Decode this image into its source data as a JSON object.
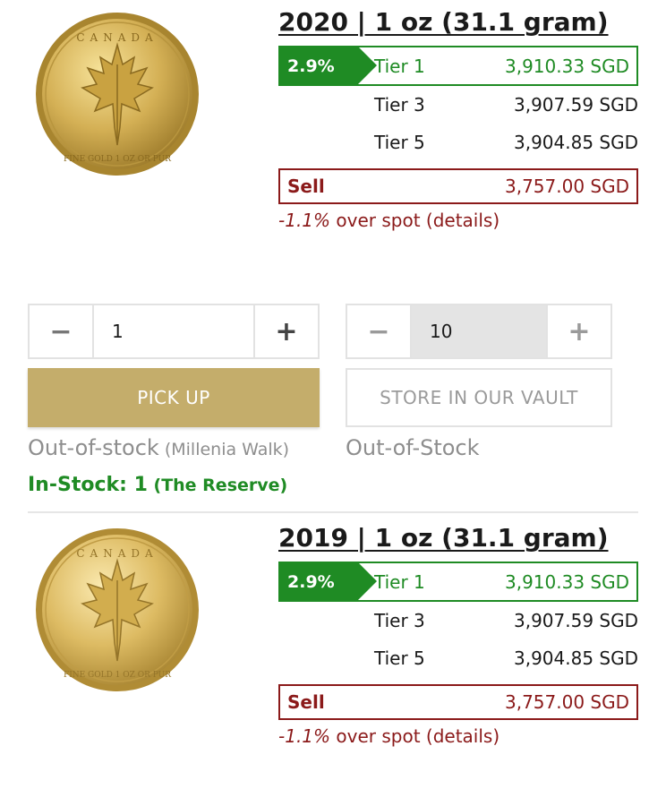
{
  "products": [
    {
      "title": "2020 | 1 oz (31.1 gram)",
      "coin_image": "gold-maple-leaf-coin-icon",
      "premium_badge": "2.9%",
      "tiers": [
        {
          "name": "Tier 1",
          "price": "3,910.33 SGD"
        },
        {
          "name": "Tier 3",
          "price": "3,907.59 SGD"
        },
        {
          "name": "Tier 5",
          "price": "3,904.85 SGD"
        }
      ],
      "sell_label": "Sell",
      "sell_price": "3,757.00 SGD",
      "spot_pct": "-1.1%",
      "spot_text": " over spot (details)"
    },
    {
      "title": "2019 | 1 oz (31.1 gram)",
      "coin_image": "gold-maple-leaf-coin-icon",
      "premium_badge": "2.9%",
      "tiers": [
        {
          "name": "Tier 1",
          "price": "3,910.33 SGD"
        },
        {
          "name": "Tier 3",
          "price": "3,907.59 SGD"
        },
        {
          "name": "Tier 5",
          "price": "3,904.85 SGD"
        }
      ],
      "sell_label": "Sell",
      "sell_price": "3,757.00 SGD",
      "spot_pct": "-1.1%",
      "spot_text": " over spot (details)"
    }
  ],
  "order": {
    "pickup": {
      "minus": "−",
      "plus": "+",
      "quantity": "1",
      "button_label": "PICK UP",
      "status_main": "Out-of-stock",
      "status_location": " (Millenia Walk)",
      "instock_main": "In-Stock: 1",
      "instock_location": " (The Reserve)"
    },
    "vault": {
      "minus": "−",
      "plus": "+",
      "quantity": "10",
      "button_label": "STORE IN OUR VAULT",
      "status_main": "Out-of-Stock"
    }
  },
  "colors": {
    "green": "#1f8b24",
    "dark_red": "#8b1a1a",
    "gold_button": "#c4ad6b"
  }
}
